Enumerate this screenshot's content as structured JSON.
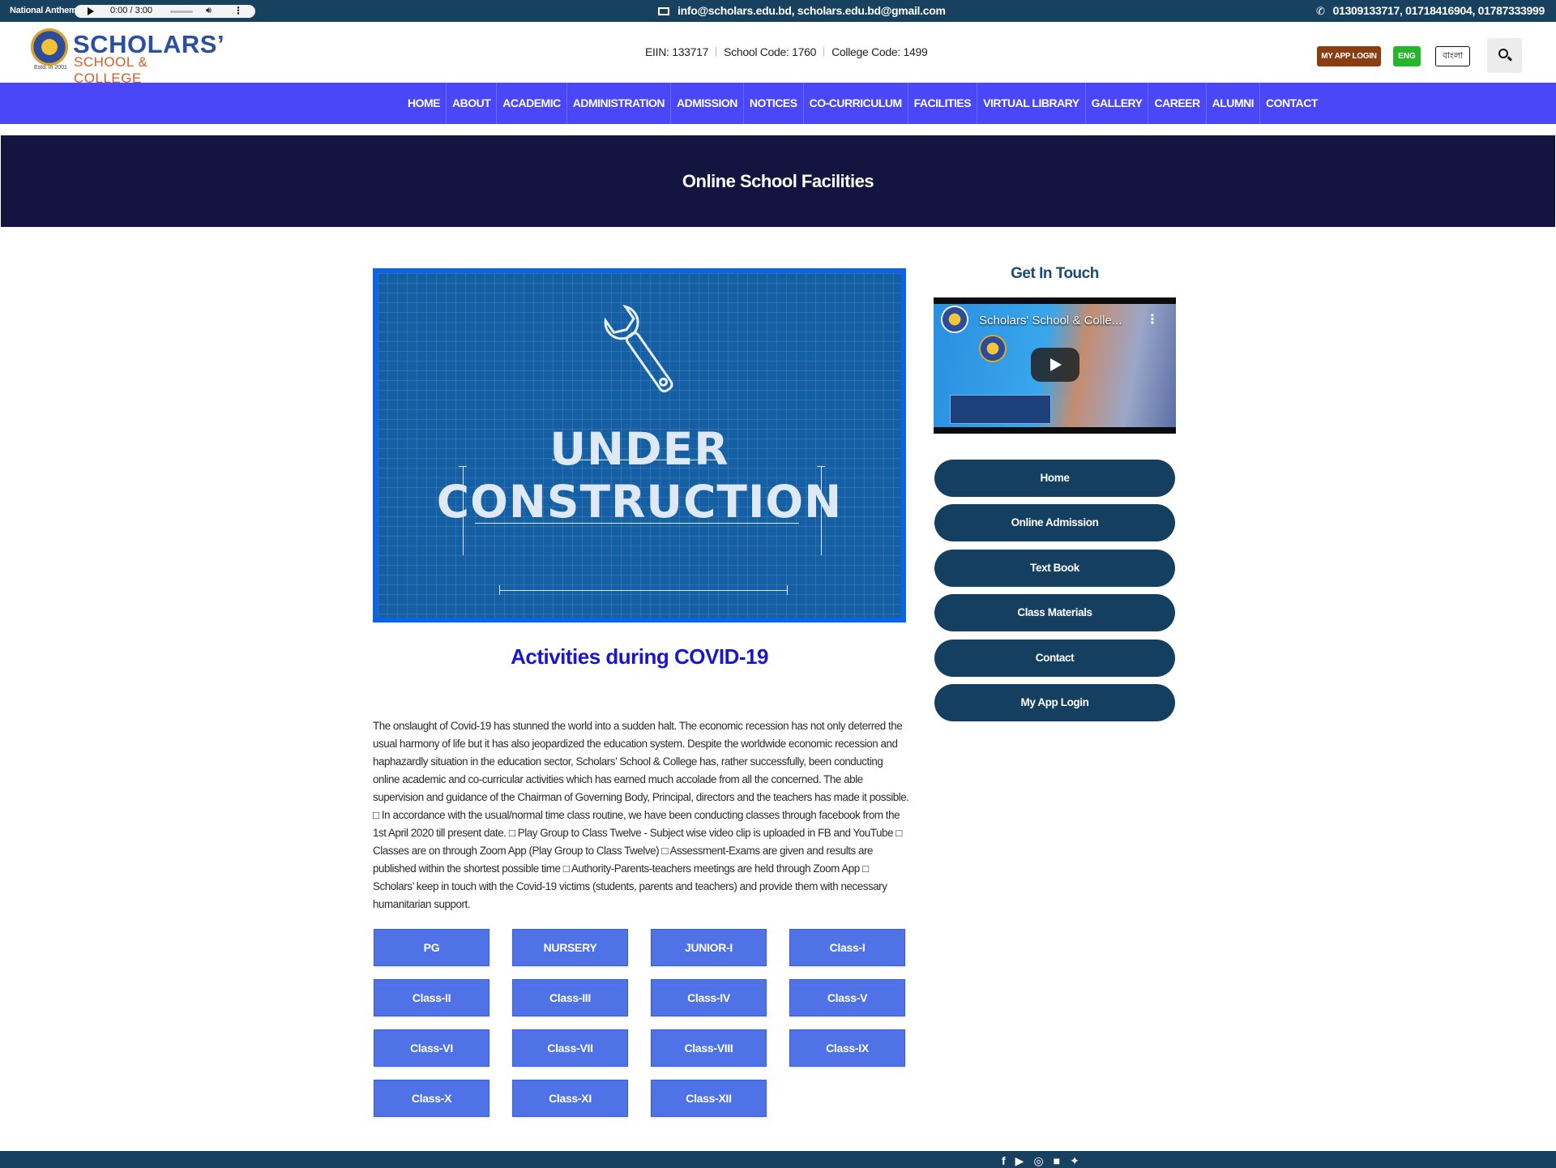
{
  "topbar": {
    "anthem_label": "National Anthem",
    "player_time": "0:00 / 3:00",
    "email": "info@scholars.edu.bd, scholars.edu.bd@gmail.com",
    "phones": "01309133717, 01718416904, 01787333999",
    "icons": {
      "play": "play-icon",
      "volume": "volume-icon",
      "more": "more-vert-icon",
      "email": "envelope-icon",
      "phone": "phone-icon"
    }
  },
  "header": {
    "logo": {
      "line1": "SCHOLARS’",
      "line2": "SCHOOL & COLLEGE",
      "estd": "Estd. in 2001"
    },
    "eiin": "EIIN: 133717",
    "school_code": "School Code: 1760",
    "college_code": "College Code: 1499",
    "app_login": "MY APP LOGIN",
    "eng": "ENG",
    "bangla": "বাংলা"
  },
  "nav": [
    "HOME",
    "ABOUT",
    "ACADEMIC",
    "ADMINISTRATION",
    "ADMISSION",
    "NOTICES",
    "CO-CURRICULUM",
    "FACILITIES",
    "VIRTUAL LIBRARY",
    "GALLERY",
    "CAREER",
    "ALUMNI",
    "CONTACT"
  ],
  "banner": {
    "title": "Online School Facilities"
  },
  "hero": {
    "line1": "UNDER",
    "line2": "CONSTRUCTION"
  },
  "section": {
    "title": "Activities during COVID-19",
    "body": "The onslaught of Covid-19 has stunned the world into a sudden halt. The economic recession has not only deterred the usual harmony of life but it has also jeopardized the education system. Despite the worldwide economic recession and haphazardly situation in the education sector, Scholars’ School & College has, rather successfully, been conducting online academic and co-curricular activities which has earned much accolade from all the concerned. The able supervision and guidance of the Chairman of Governing Body, Principal, directors and the teachers has made it possible. □ In accordance with the usual/normal time class routine, we have been conducting classes through facebook from the 1st April 2020 till present date. □ Play Group to Class Twelve - Subject wise video clip is uploaded in FB and YouTube □ Classes are on through Zoom App (Play Group to Class Twelve) □ Assessment-Exams are given and results are published within the shortest possible time □ Authority-Parents-teachers meetings are held through Zoom App □ Scholars’ keep in touch with the Covid-19 victims (students, parents and teachers) and provide them with necessary humanitarian support."
  },
  "classes": [
    "PG",
    "NURSERY",
    "JUNIOR-I",
    "Class-I",
    "Class-II",
    "Class-III",
    "Class-IV",
    "Class-V",
    "Class-VI",
    "Class-VII",
    "Class-VIII",
    "Class-IX",
    "Class-X",
    "Class-XI",
    "Class-XII"
  ],
  "sidebar": {
    "title": "Get In Touch",
    "video_title": "Scholars' School & Colle...",
    "links": [
      "Home",
      "Online Admission",
      "Text Book",
      "Class Materials",
      "Contact",
      "My App Login"
    ]
  },
  "footer": {
    "social_icons": [
      "facebook-icon",
      "youtube-icon",
      "instagram-icon",
      "linkedin-icon",
      "twitter-icon"
    ]
  }
}
